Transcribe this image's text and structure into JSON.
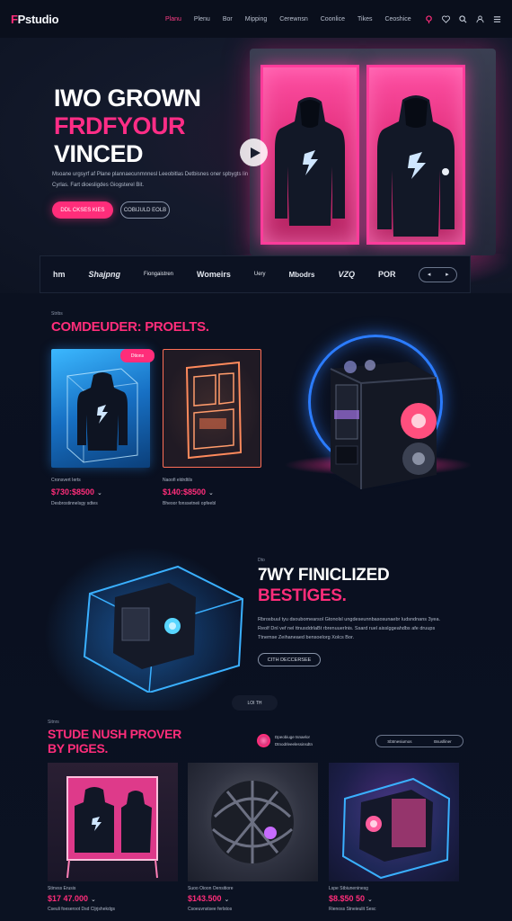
{
  "nav": {
    "logo_mark": "F",
    "logo_text": "Pstudio",
    "menu": [
      "Planu",
      "Plenu",
      "Bor",
      "Mipping",
      "Cerewnsn",
      "Coonlice",
      "Tikes",
      "Ceoshice"
    ],
    "icons": [
      "pin-icon",
      "heart-icon",
      "search-icon",
      "user-icon",
      "menu-icon"
    ]
  },
  "hero": {
    "line1": "IWO GROWN",
    "line2": "FRDFYOUR",
    "line3": "VINCED",
    "desc": "Msoane urgsyrf af Plane plannaecunmnnesl Leeobitlas Detbisnes oner spbygts lin Cyrlas. Fart dioesligdes Giogsterel Bit.",
    "primary_button": "DDL CKSES KIES",
    "secondary_button": "COBIJULD EOLB"
  },
  "brands": {
    "items": [
      "hm",
      "Shajpng",
      "Fiongaistren",
      "Womeirs",
      "Uery",
      "Mbodrs",
      "VZQ",
      "POR"
    ],
    "arrows": [
      "◂",
      "▸"
    ]
  },
  "featured": {
    "kicker": "Stribs",
    "title": "COMDEUDER: PROELTS.",
    "tag": "Dtions",
    "products": [
      {
        "meta": "Cronsvert Ierts",
        "price": "$730:$8500",
        "sub": "Desbrostinnelsgy sdtes"
      },
      {
        "meta": "Naoofi eldrdtils",
        "price": "$140:$8500",
        "sub": "Bheoor fonssetneii opfeebl"
      }
    ]
  },
  "section2": {
    "kicker": "Dto",
    "title_line1": "7WY FINICLIZED",
    "title_line2": "BESTIGES.",
    "desc": "Rbrosbuul tyu dsoubomearsol Gtonolsl ungdeseunnbasosunaebr ludsndnans 3yea. Reolf Dnl vef nel ttnusddrlaBt rbrenuuerlnis. Ssard ruel aisslggeahdbs afe druups Ttnemse Zeihaneaed bensoelorg Xolcs Bor.",
    "button": "CITH DECCERSEE",
    "pager": "LOI TH"
  },
  "section3": {
    "kicker": "Sitnrs",
    "title_line1": "STUDE NUSH PROVER",
    "title_line2": "BY PIGES.",
    "author_line1": "Dpeobiuge tsnaelor",
    "author_line2": "Dtnodrleeelessinsdtn",
    "tabs": [
      "Sbtmesiumos",
      "Bsuslliner"
    ],
    "products": [
      {
        "meta": "Stinvss Erusis",
        "price": "$17 47.000",
        "sub": "Cseuli foeseroot Dsd Cljrjshekdgs"
      },
      {
        "meta": "Suoo Oioon Oensitiore",
        "price": "$143.500",
        "sub": "Csoeuvnstsee ferlstos"
      },
      {
        "meta": "Lspe Stbiuneninesg",
        "price": "$8.$50 50",
        "sub": "Rienoss Stneieulit Sesc"
      }
    ]
  },
  "colors": {
    "accent": "#ff2d7a",
    "neon_blue": "#2b7cff",
    "background": "#0b1120"
  }
}
